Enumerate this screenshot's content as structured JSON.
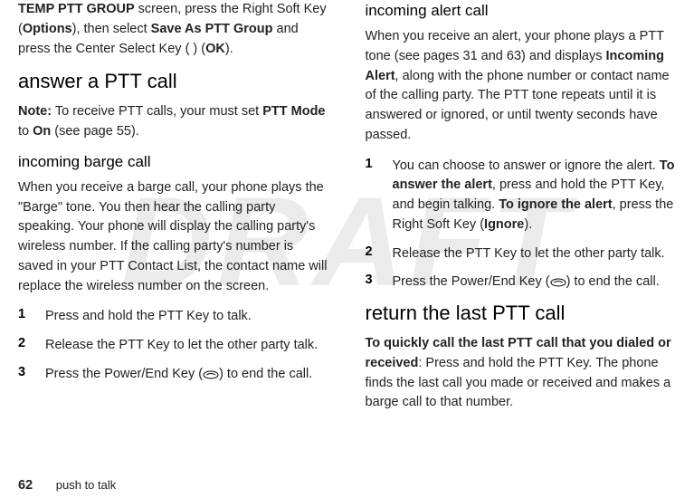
{
  "watermark": "DRAFT",
  "left": {
    "intro": {
      "p1a": "TEMP PTT GROUP",
      "p1b": " screen, press the Right Soft Key (",
      "p1c": "Options",
      "p1d": "), then select ",
      "p1e": "Save As PTT Group",
      "p1f": " and press the Center Select Key ( ) (",
      "p1g": "OK",
      "p1h": ")."
    },
    "h1": "answer a PTT call",
    "note": {
      "a": "Note:",
      "b": " To receive PTT calls, your must set ",
      "c": "PTT Mode",
      "d": " to ",
      "e": "On",
      "f": " (see page 55)."
    },
    "h2": "incoming barge call",
    "p2": "When you receive a barge call, your phone plays the \"Barge\" tone. You then hear the calling party speaking. Your phone will display the calling party's wireless number. If the calling party's number is saved in your PTT Contact List, the contact name will replace the wireless number on the screen.",
    "steps": [
      {
        "n": "1",
        "t": "Press and hold the PTT Key to talk."
      },
      {
        "n": "2",
        "t": "Release the PTT Key to let the other party talk."
      },
      {
        "n": "3",
        "t": "Press the Power/End Key ( ) to end the call."
      }
    ]
  },
  "right": {
    "h1": "incoming alert call",
    "p1": {
      "a": "When you receive an alert, your phone plays a PTT tone (see pages 31 and 63) and displays ",
      "b": "Incoming Alert",
      "c": ", along with the phone number or contact name of the calling party. The PTT tone repeats until it is answered or ignored, or until twenty seconds have passed."
    },
    "steps": [
      {
        "n": "1",
        "a": "You can choose to answer or ignore the alert. ",
        "b": "To answer the alert",
        "c": ", press and hold the PTT Key, and begin talking. ",
        "d": "To ignore the alert",
        "e": ", press the Right Soft Key (",
        "f": "Ignore",
        "g": ")."
      },
      {
        "n": "2",
        "t": "Release the PTT Key to let the other party talk."
      },
      {
        "n": "3",
        "t": "Press the Power/End Key ( ) to end the call."
      }
    ],
    "h2": "return the last PTT call",
    "p2": {
      "a": "To quickly call the last PTT call that you dialed or received",
      "b": ": Press and hold the PTT Key. The phone finds the last call you made or received and makes a barge call to that number."
    }
  },
  "footer": {
    "page": "62",
    "section": "push to talk"
  }
}
